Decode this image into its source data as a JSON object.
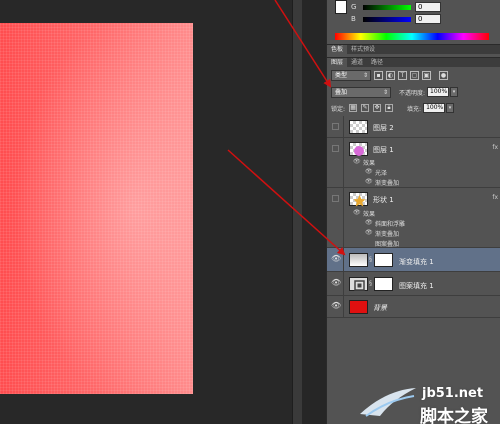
{
  "mini_toolbar": {
    "label": "⊞"
  },
  "color_panel": {
    "sliders": [
      {
        "label": "G",
        "value": "0",
        "color_from": "#000000",
        "color_to": "#00ff00"
      },
      {
        "label": "B",
        "value": "0",
        "color_from": "#000000",
        "color_to": "#0000ff"
      }
    ],
    "foreground_color": "#ffffff"
  },
  "panel_tabs_top": [
    "色板",
    "样式预设"
  ],
  "panel_tabs_layers": [
    "图层",
    "通道",
    "路径"
  ],
  "layer_controls": {
    "filter_type": "类型",
    "blend_mode": "叠加",
    "opacity_label": "不透明度:",
    "opacity_value": "100%",
    "lock_label": "锁定:",
    "fill_label": "填充:",
    "fill_value": "100%"
  },
  "layers": [
    {
      "name": "图层 2",
      "visible": false,
      "thumb": "checker"
    },
    {
      "name": "图层 1",
      "visible": false,
      "thumb": "pink-blob",
      "fx": "fx",
      "effects_label": "效果",
      "effects": [
        "光泽",
        "渐变叠加"
      ]
    },
    {
      "name": "形状 1",
      "visible": false,
      "thumb": "star",
      "fx": "fx",
      "effects_label": "效果",
      "effects": [
        "斜面和浮雕",
        "渐变叠加",
        "图案叠加"
      ]
    },
    {
      "name": "渐变填充 1",
      "visible": true,
      "selected": true,
      "thumb": "gradient-fill"
    },
    {
      "name": "图案填充 1",
      "visible": true,
      "thumb": "pattern-fill"
    },
    {
      "name": "背景",
      "visible": true,
      "thumb": "red-fill"
    }
  ],
  "canvas": {
    "base_color": "#ff4d4f",
    "highlight_color": "#ff9a9a"
  },
  "arrow_color": "#d01010",
  "watermark": {
    "site": "jb51.net",
    "name": "脚本之家"
  }
}
